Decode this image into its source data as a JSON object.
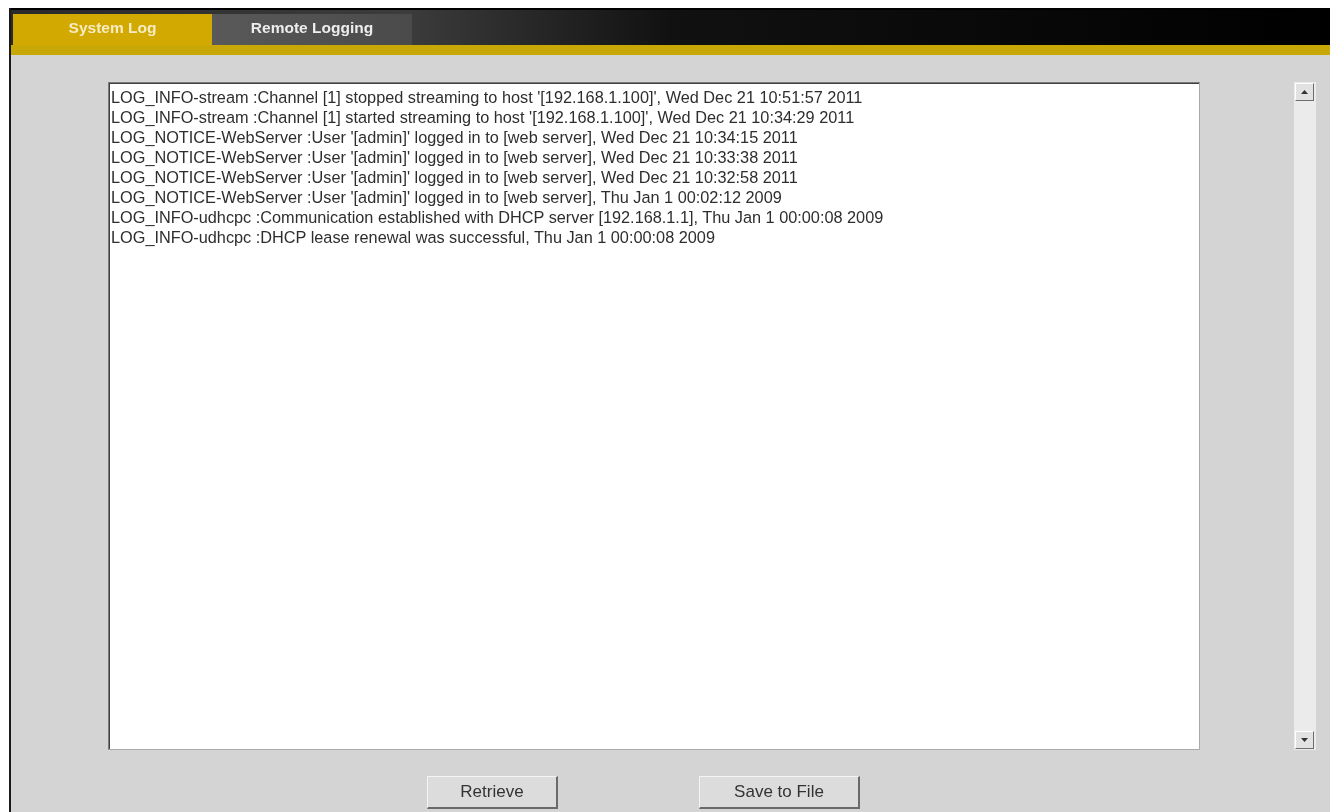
{
  "tabs": [
    {
      "label": "System Log",
      "selected": true
    },
    {
      "label": "Remote Logging",
      "selected": false
    }
  ],
  "log": {
    "lines": [
      "LOG_INFO-stream :Channel [1] stopped streaming to host '[192.168.1.100]', Wed Dec 21 10:51:57 2011",
      "LOG_INFO-stream :Channel [1] started streaming to host '[192.168.1.100]', Wed Dec 21 10:34:29 2011",
      "LOG_NOTICE-WebServer :User '[admin]' logged in to [web server], Wed Dec 21 10:34:15 2011",
      "LOG_NOTICE-WebServer :User '[admin]' logged in to [web server], Wed Dec 21 10:33:38 2011",
      "LOG_NOTICE-WebServer :User '[admin]' logged in to [web server], Wed Dec 21 10:32:58 2011",
      "LOG_NOTICE-WebServer :User '[admin]' logged in to [web server], Thu Jan 1 00:02:12 2009",
      "LOG_INFO-udhcpc :Communication established with DHCP server [192.168.1.1], Thu Jan 1 00:00:08 2009",
      "LOG_INFO-udhcpc :DHCP lease renewal was successful, Thu Jan 1 00:00:08 2009"
    ]
  },
  "buttons": [
    "Retrieve",
    "Save to File"
  ]
}
